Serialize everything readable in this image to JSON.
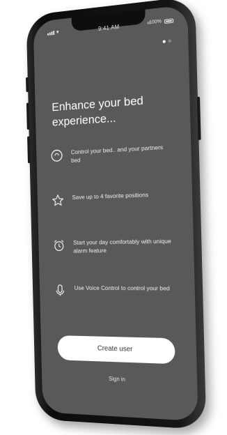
{
  "status_bar": {
    "time": "9:41 AM",
    "battery": "100%"
  },
  "onboarding": {
    "title": "Enhance your bed experience...",
    "page_dots": [
      true,
      false
    ],
    "features": [
      {
        "icon": "dial-icon",
        "text": "Control your bed.. and your partners bed"
      },
      {
        "icon": "star-icon",
        "text": "Save up to 4 favorite positions"
      },
      {
        "icon": "alarm-clock-icon",
        "text": "Start your day comfortably with unique alarm feature"
      },
      {
        "icon": "microphone-icon",
        "text": "Use Voice Control to control your bed"
      }
    ],
    "create_user_label": "Create user",
    "sign_in_label": "Sign in"
  }
}
